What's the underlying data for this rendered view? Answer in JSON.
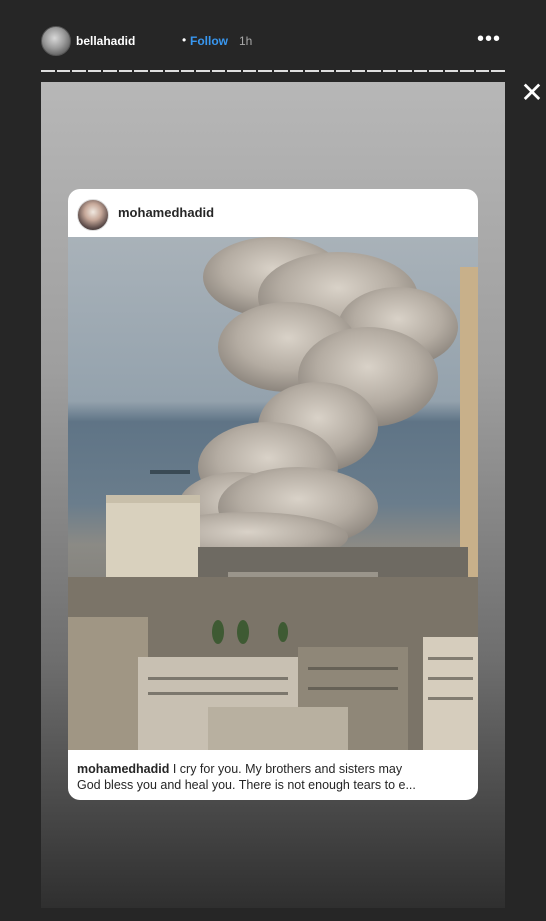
{
  "header": {
    "username": "bellahadid",
    "separator": "•",
    "follow": "Follow",
    "time": "1h",
    "more": "•••"
  },
  "close_glyph": "✕",
  "story": {
    "post": {
      "username": "mohamedhadid",
      "caption_user": "mohamedhadid",
      "caption_line1": " I cry for you. My brothers and sisters may",
      "caption_line2": "God bless you and heal you.  There is not enough tears to e..."
    }
  }
}
